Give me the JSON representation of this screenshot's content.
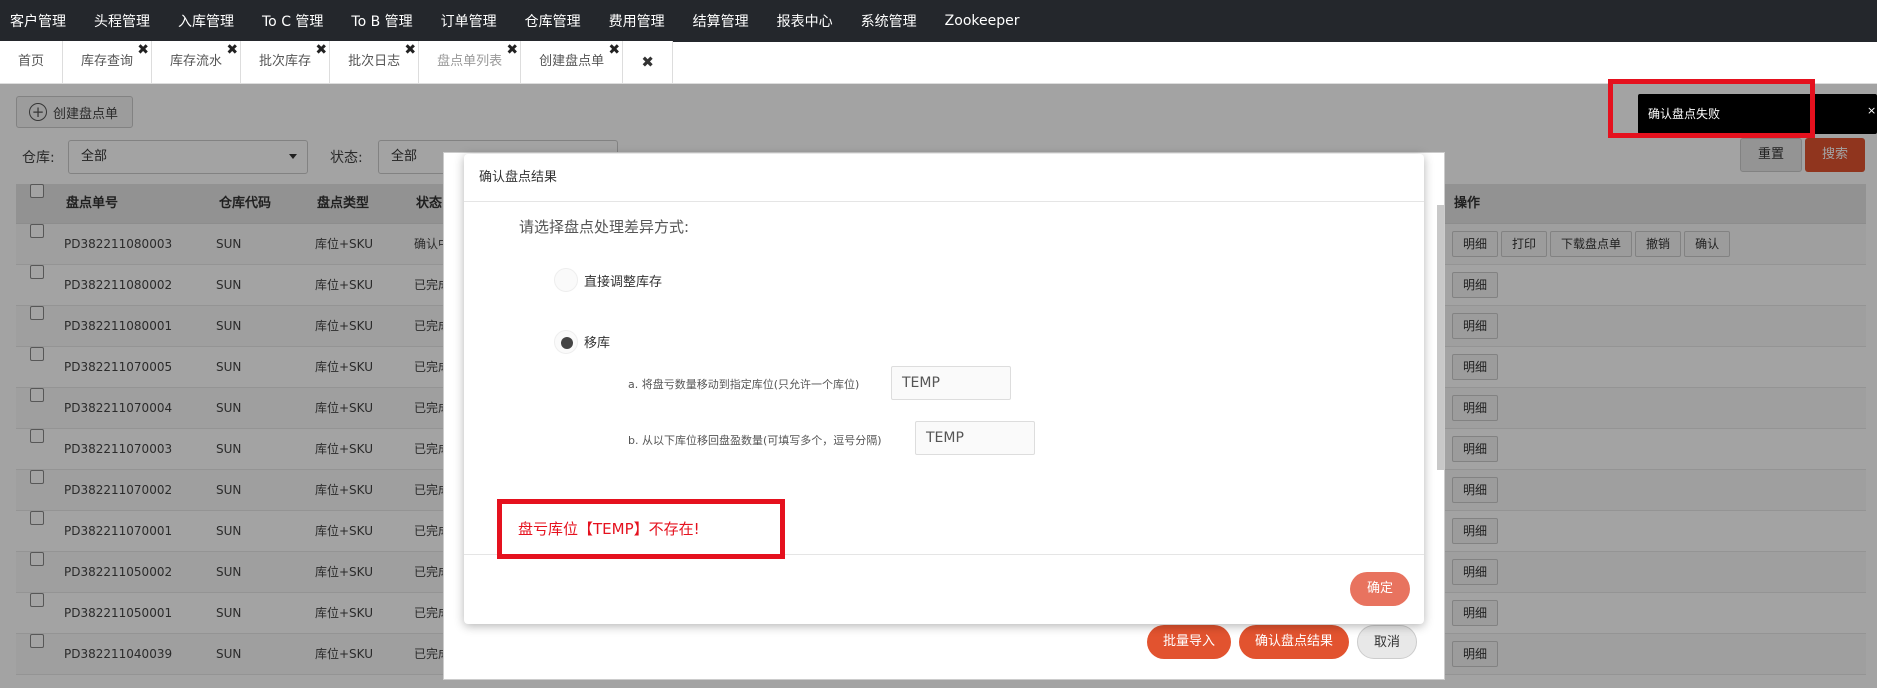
{
  "topnav": {
    "items": [
      "客户管理",
      "头程管理",
      "入库管理",
      "To C 管理",
      "To B 管理",
      "订单管理",
      "仓库管理",
      "费用管理",
      "结算管理",
      "报表中心",
      "系统管理",
      "Zookeeper"
    ]
  },
  "tabs": {
    "items": [
      "首页",
      "库存查询",
      "库存流水",
      "批次库存",
      "批次日志",
      "盘点单列表",
      "创建盘点单"
    ],
    "active_index": 5,
    "close_all_label": "✖"
  },
  "page": {
    "create_button": "创建盘点单",
    "warehouse_label": "仓库:",
    "warehouse_value": "全部",
    "status_label": "状态:",
    "status_value": "全部",
    "reset_button": "重置",
    "search_button": "搜索"
  },
  "table": {
    "headers": [
      "盘点单号",
      "仓库代码",
      "盘点类型",
      "状态",
      "操作"
    ],
    "rows": [
      {
        "no": "PD382211080003",
        "wh": "SUN",
        "type": "库位+SKU",
        "status": "确认中",
        "ops": [
          "明细",
          "打印",
          "下载盘点单",
          "撤销",
          "确认"
        ]
      },
      {
        "no": "PD382211080002",
        "wh": "SUN",
        "type": "库位+SKU",
        "status": "已完成",
        "ops": [
          "明细"
        ]
      },
      {
        "no": "PD382211080001",
        "wh": "SUN",
        "type": "库位+SKU",
        "status": "已完成",
        "ops": [
          "明细"
        ]
      },
      {
        "no": "PD382211070005",
        "wh": "SUN",
        "type": "库位+SKU",
        "status": "已完成",
        "ops": [
          "明细"
        ]
      },
      {
        "no": "PD382211070004",
        "wh": "SUN",
        "type": "库位+SKU",
        "status": "已完成",
        "ops": [
          "明细"
        ]
      },
      {
        "no": "PD382211070003",
        "wh": "SUN",
        "type": "库位+SKU",
        "status": "已完成",
        "ops": [
          "明细"
        ]
      },
      {
        "no": "PD382211070002",
        "wh": "SUN",
        "type": "库位+SKU",
        "status": "已完成",
        "ops": [
          "明细"
        ]
      },
      {
        "no": "PD382211070001",
        "wh": "SUN",
        "type": "库位+SKU",
        "status": "已完成",
        "ops": [
          "明细"
        ]
      },
      {
        "no": "PD382211050002",
        "wh": "SUN",
        "type": "库位+SKU",
        "status": "已完成",
        "ops": [
          "明细"
        ]
      },
      {
        "no": "PD382211050001",
        "wh": "SUN",
        "type": "库位+SKU",
        "status": "已完成",
        "ops": [
          "明细"
        ]
      },
      {
        "no": "PD382211040039",
        "wh": "SUN",
        "type": "库位+SKU",
        "status": "已完成",
        "ops": [
          "明细"
        ]
      }
    ]
  },
  "outer_dialog": {
    "footer_buttons": [
      "批量导入",
      "确认盘点结果",
      "取消"
    ]
  },
  "dialog": {
    "title": "确认盘点结果",
    "prompt": "请选择盘点处理差异方式:",
    "option1": "直接调整库存",
    "option2": "移库",
    "sub_a_label": "a. 将盘亏数量移动到指定库位(只允许一个库位)",
    "sub_a_value": "TEMP",
    "sub_b_label": "b. 从以下库位移回盘盈数量(可填写多个，逗号分隔)",
    "sub_b_value": "TEMP",
    "error": "盘亏库位【TEMP】不存在!",
    "ok_button": "确定"
  },
  "toast": {
    "message": "确认盘点失败",
    "close": "×"
  },
  "colors": {
    "nav_bg": "#24272c",
    "accent": "#e2532f",
    "error": "#e5111e"
  }
}
